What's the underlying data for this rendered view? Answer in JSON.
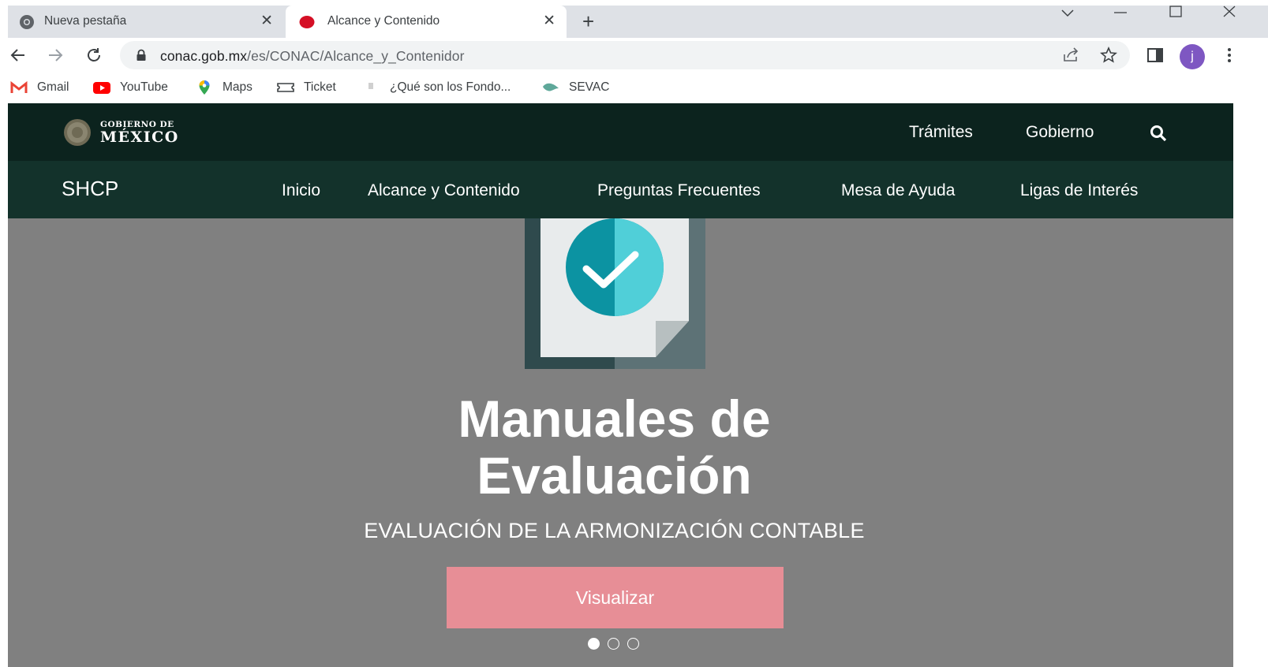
{
  "browser": {
    "tabs": [
      {
        "title": "Nueva pestaña",
        "close": "✕"
      },
      {
        "title": "Alcance y Contenido",
        "close": "✕"
      }
    ],
    "new_tab": "+",
    "url_host": "conac.gob.mx",
    "url_path": "/es/CONAC/Alcance_y_Contenidor",
    "avatar_letter": "j",
    "bookmarks": [
      "Gmail",
      "YouTube",
      "Maps",
      "Ticket",
      "¿Qué son los Fondo...",
      "SEVAC"
    ]
  },
  "site": {
    "gob_logo": {
      "line1": "GOBIERNO DE",
      "line2": "MÉXICO"
    },
    "gob_links": [
      "Trámites",
      "Gobierno"
    ],
    "brand": "SHCP",
    "nav": [
      "Inicio",
      "Alcance y Contenido",
      "Preguntas Frecuentes",
      "Mesa de Ayuda",
      "Ligas de Interés"
    ],
    "hero": {
      "title_line1": "Manuales de",
      "title_line2": "Evaluación",
      "subtitle": "EVALUACIÓN DE LA ARMONIZACIÓN CONTABLE",
      "button": "Visualizar",
      "slides": 3,
      "active_slide": 1
    }
  },
  "colors": {
    "gob_bar": "#0c231e",
    "nav_bar": "#13322b",
    "hero_bg": "#808080",
    "button": "#e78e96"
  }
}
